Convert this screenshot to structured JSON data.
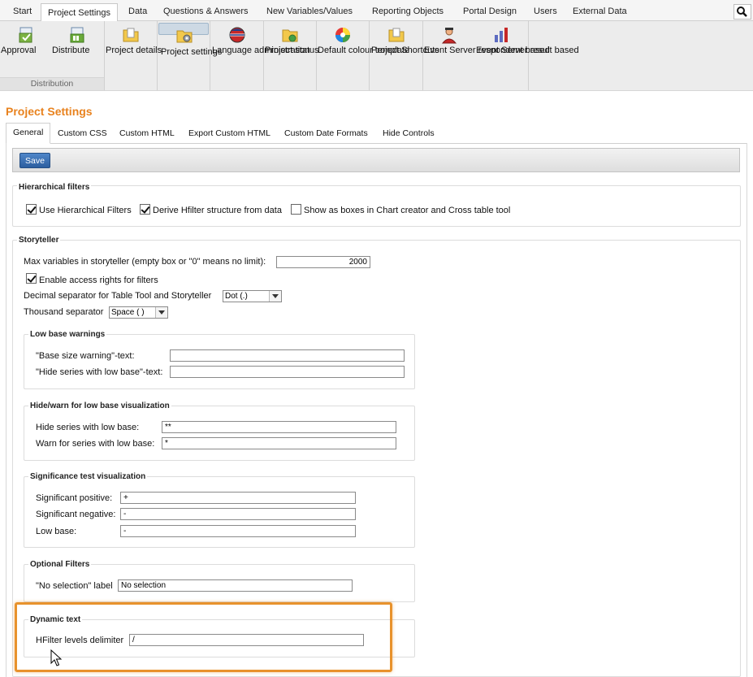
{
  "menu": {
    "tabs": [
      "Start",
      "Project Settings",
      "Data",
      "Questions & Answers",
      "New Variables/Values",
      "Reporting Objects",
      "Portal Design",
      "Users",
      "External Data"
    ],
    "active": "Project Settings"
  },
  "ribbon": {
    "distribution_group_label": "Distribution",
    "buttons": {
      "approval": "Approval",
      "distribute": "Distribute",
      "project_details": "Project details",
      "project_settings": "Project settings",
      "language_administration": "Language administration",
      "project_status": "Project status",
      "default_colour_template": "Default colour template",
      "project_shortcuts": "Project Shortcuts",
      "event_server_respondent": "Event Server respondent based",
      "event_server_result": "Event Server result based"
    }
  },
  "page": {
    "title": "Project Settings",
    "tabs": [
      "General",
      "Custom CSS",
      "Custom HTML",
      "Export Custom HTML",
      "Custom Date Formats",
      "Hide Controls"
    ],
    "active_tab": "General",
    "save_label": "Save"
  },
  "hierarchical_filters": {
    "title": "Hierarchical filters",
    "use_label": "Use Hierarchical Filters",
    "use_checked": true,
    "derive_label": "Derive Hfilter structure from data",
    "derive_checked": true,
    "boxes_label": "Show as boxes in Chart creator and Cross table tool",
    "boxes_checked": false
  },
  "storyteller": {
    "title": "Storyteller",
    "max_vars_label": "Max variables in storyteller (empty box or \"0\" means no limit):",
    "max_vars_value": "2000",
    "access_rights_label": "Enable access rights for filters",
    "access_rights_checked": true,
    "decimal_label": "Decimal separator for Table Tool and Storyteller",
    "decimal_value": "Dot (.)",
    "thousand_label": "Thousand separator",
    "thousand_value": "Space ( )"
  },
  "low_base_warnings": {
    "title": "Low base warnings",
    "base_size_label": "\"Base size warning\"-text:",
    "base_size_value": "",
    "hide_series_label": "\"Hide series with low base\"-text:",
    "hide_series_value": ""
  },
  "hide_warn": {
    "title": "Hide/warn for low base visualization",
    "hide_label": "Hide series with low base:",
    "hide_value": "**",
    "warn_label": "Warn for series with low base:",
    "warn_value": "*"
  },
  "significance": {
    "title": "Significance test visualization",
    "pos_label": "Significant positive:",
    "pos_value": "+",
    "neg_label": "Significant negative:",
    "neg_value": "-",
    "low_label": "Low base:",
    "low_value": "-"
  },
  "optional_filters": {
    "title": "Optional Filters",
    "no_selection_label": "\"No selection\" label",
    "no_selection_value": "No selection"
  },
  "dynamic_text": {
    "title": "Dynamic text",
    "delimiter_label": "HFilter levels delimiter",
    "delimiter_value": "/"
  },
  "colors": {
    "accent": "#e8821e",
    "highlight": "#e8922c",
    "save_button": "#3a6fb2"
  }
}
